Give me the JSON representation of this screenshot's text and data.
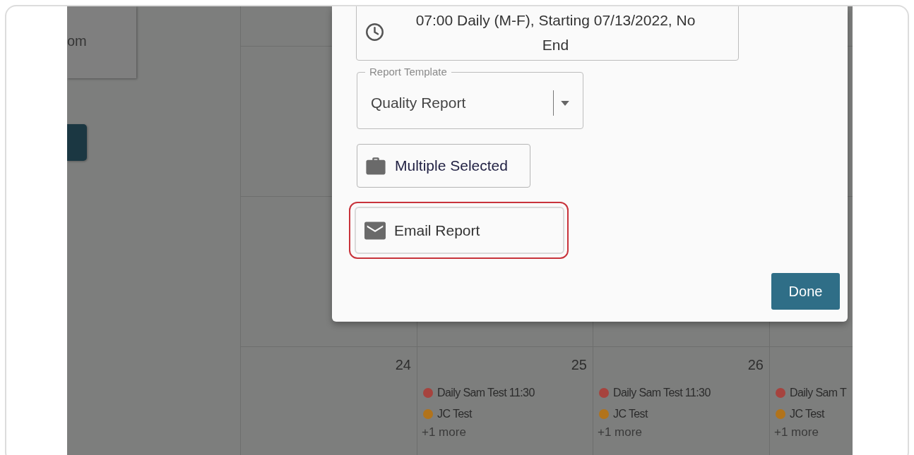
{
  "sidebar": {
    "card_text": "om"
  },
  "calendar": {
    "days": [
      {
        "date": "24"
      },
      {
        "date": "25",
        "events": [
          {
            "title": "Daily Sam Test 11:30",
            "color": "#a6433e"
          },
          {
            "title": "JC Test",
            "color": "#b1731b"
          }
        ],
        "more": "+1 more"
      },
      {
        "date": "26",
        "events": [
          {
            "title": "Daily Sam Test 11:30",
            "color": "#a6433e"
          },
          {
            "title": "JC Test",
            "color": "#b1731b"
          }
        ],
        "more": "+1 more"
      },
      {
        "events": [
          {
            "title": "Daily Sam T",
            "color": "#a6433e"
          },
          {
            "title": "JC Test",
            "color": "#b1731b"
          }
        ],
        "more": "+1 more"
      }
    ]
  },
  "dialog": {
    "schedule": {
      "text": "07:00 Daily (M-F), Starting 07/13/2022, No End"
    },
    "report_template": {
      "label": "Report Template",
      "value": "Quality Report"
    },
    "scope_button": {
      "label": "Multiple Selected"
    },
    "email_button": {
      "label": "Email Report",
      "highlighted": true
    },
    "done_button": {
      "label": "Done"
    }
  }
}
